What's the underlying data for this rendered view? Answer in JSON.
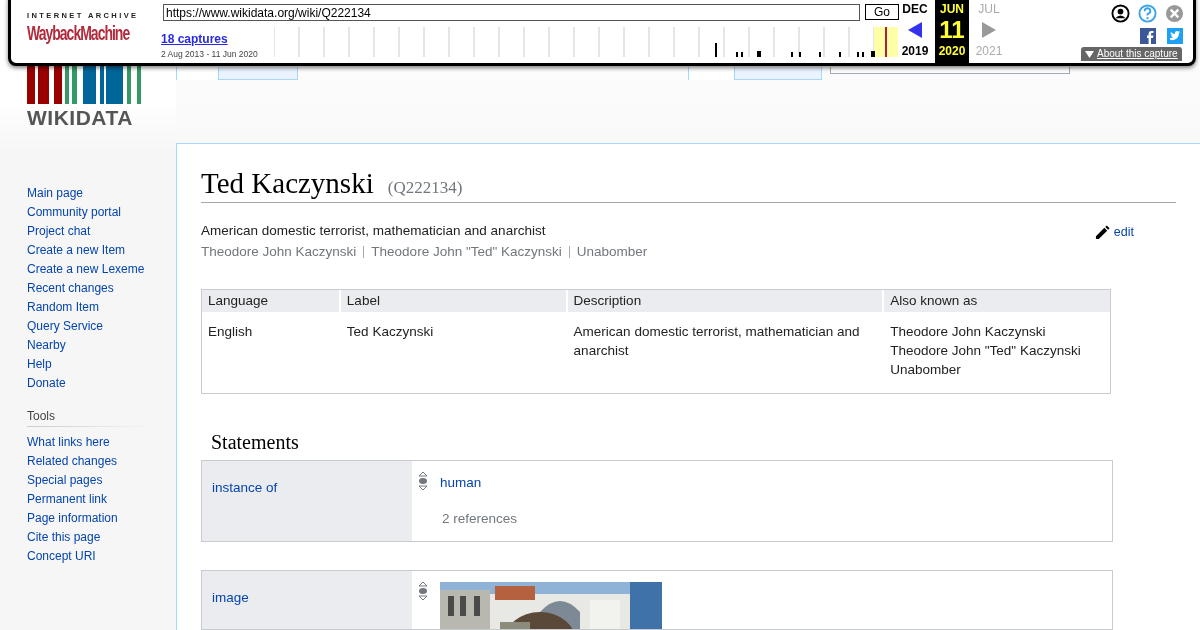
{
  "wayback": {
    "brand_top": "INTERNET ARCHIVE",
    "brand": "WaybackMachine",
    "url": "https://www.wikidata.org/wiki/Q222134",
    "go": "Go",
    "captures": "18 captures",
    "range": "2 Aug 2013 - 11 Jun 2020",
    "months": [
      {
        "month": "DEC",
        "year": "2019",
        "selected": false,
        "disabled": false
      },
      {
        "month": "JUN",
        "day": "11",
        "year": "2020",
        "selected": true,
        "disabled": false
      },
      {
        "month": "JUL",
        "year": "2021",
        "selected": false,
        "disabled": true
      }
    ],
    "about": "About this capture"
  },
  "logo": {
    "wordmark": "WIKIDATA"
  },
  "sidebar": {
    "nav": [
      "Main page",
      "Community portal",
      "Project chat",
      "Create a new Item",
      "Create a new Lexeme",
      "Recent changes",
      "Random Item",
      "Query Service",
      "Nearby",
      "Help",
      "Donate"
    ],
    "tools_heading": "Tools",
    "tools": [
      "What links here",
      "Related changes",
      "Special pages",
      "Permanent link",
      "Page information",
      "Cite this page",
      "Concept URI"
    ]
  },
  "page": {
    "title": "Ted Kaczynski",
    "id": "(Q222134)",
    "description": "American domestic terrorist, mathematician and anarchist",
    "aliases": [
      "Theodore John Kaczynski",
      "Theodore John \"Ted\" Kaczynski",
      "Unabomber"
    ],
    "edit": "edit"
  },
  "terms_table": {
    "columns": [
      "Language",
      "Label",
      "Description",
      "Also known as"
    ],
    "rows": [
      {
        "language": "English",
        "label": "Ted Kaczynski",
        "description": "American domestic terrorist, mathematician and anarchist",
        "aliases": [
          "Theodore John Kaczynski",
          "Theodore John \"Ted\" Kaczynski",
          "Unabomber"
        ]
      }
    ]
  },
  "statements": {
    "heading": "Statements",
    "items": [
      {
        "property": "instance of",
        "kind": "item",
        "value": "human",
        "references": "2 references"
      },
      {
        "property": "image",
        "kind": "picture"
      }
    ]
  }
}
